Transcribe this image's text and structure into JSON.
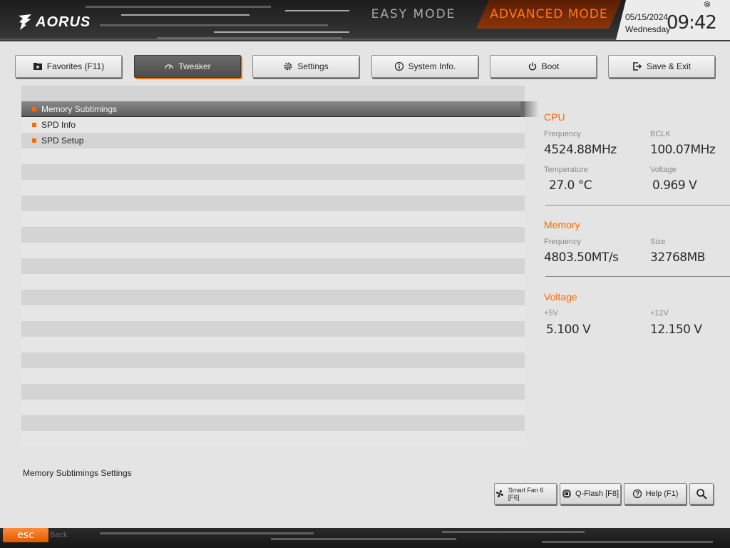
{
  "header": {
    "brand": "AORUS",
    "easy_mode": "EASY MODE",
    "advanced_mode": "ADVANCED MODE",
    "date": "05/15/2024",
    "weekday": "Wednesday",
    "time": "09:42"
  },
  "tabs": [
    {
      "label": "Favorites (F11)",
      "icon": "star-folder-icon",
      "active": false
    },
    {
      "label": "Tweaker",
      "icon": "speedometer-icon",
      "active": true
    },
    {
      "label": "Settings",
      "icon": "gear-icon",
      "active": false
    },
    {
      "label": "System Info.",
      "icon": "info-icon",
      "active": false
    },
    {
      "label": "Boot",
      "icon": "power-icon",
      "active": false
    },
    {
      "label": "Save & Exit",
      "icon": "exit-icon",
      "active": false
    }
  ],
  "menu": {
    "items": [
      {
        "label": "Memory Subtimings",
        "selected": true
      },
      {
        "label": "SPD Info",
        "selected": false
      },
      {
        "label": "SPD Setup",
        "selected": false
      }
    ]
  },
  "info": {
    "cpu": {
      "title": "CPU",
      "frequency_label": "Frequency",
      "frequency": "4524.88MHz",
      "bclk_label": "BCLK",
      "bclk": "100.07MHz",
      "temperature_label": "Temperature",
      "temperature": "27.0 °C",
      "voltage_label": "Voltage",
      "voltage": "0.969 V"
    },
    "memory": {
      "title": "Memory",
      "frequency_label": "Frequency",
      "frequency": "4803.50MT/s",
      "size_label": "Size",
      "size": "32768MB"
    },
    "voltage": {
      "title": "Voltage",
      "v5_label": "+5V",
      "v5": "5.100 V",
      "v12_label": "+12V",
      "v12": "12.150 V"
    }
  },
  "footer": {
    "help_text": "Memory Subtimings Settings",
    "smart_fan": "Smart Fan 6 [F6]",
    "qflash": "Q-Flash [F8]",
    "help": "Help (F1)",
    "esc": "esc",
    "esc_label": "Back"
  },
  "colors": {
    "accent": "#ff6a00",
    "background": "#e4e4e4",
    "banner": "#2b2b2b"
  }
}
